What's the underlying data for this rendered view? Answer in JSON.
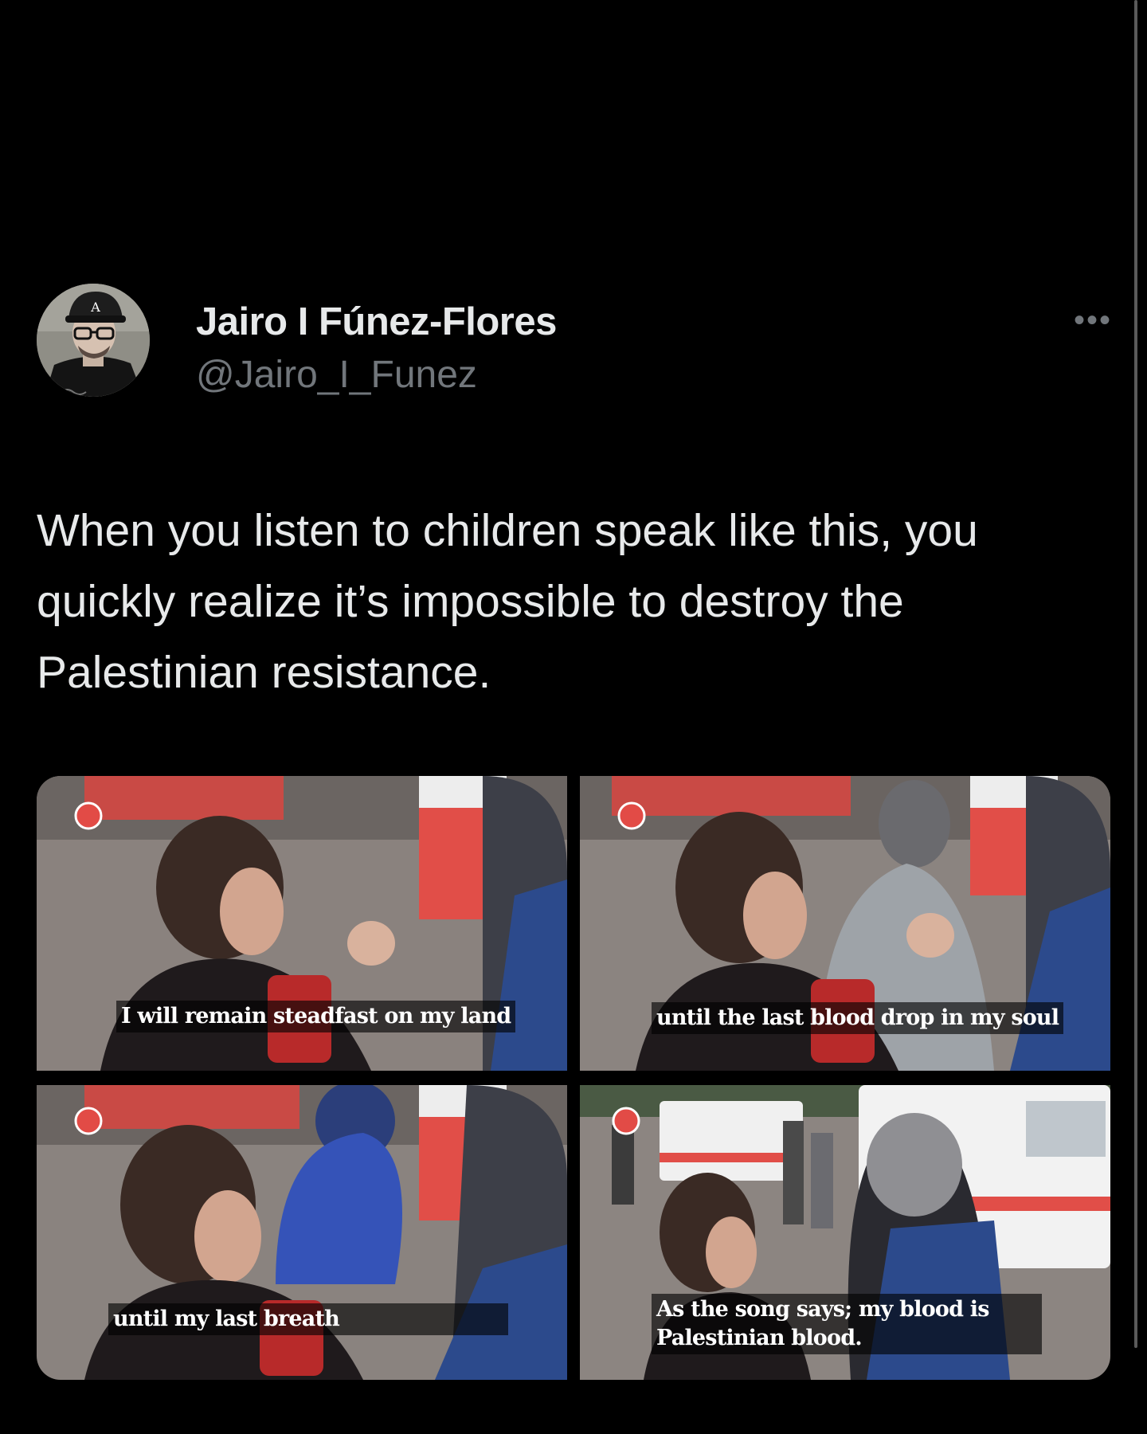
{
  "tweet": {
    "display_name": "Jairo I Fúnez-Flores",
    "handle": "@Jairo_I_Funez",
    "more_label": "•••",
    "text": "When you listen to children speak like this, you quickly realize it’s impossible to destroy the Palestinian resistance."
  },
  "media": {
    "captions": [
      "I will remain steadfast on my land",
      "until the last blood drop in my soul",
      "until my last breath",
      "As the song says; my blood is Palestinian blood."
    ]
  },
  "icons": {
    "more": "more-horizontal-icon"
  },
  "colors": {
    "background": "#000000",
    "text_primary": "#e7e9ea",
    "text_secondary": "#71767b"
  }
}
